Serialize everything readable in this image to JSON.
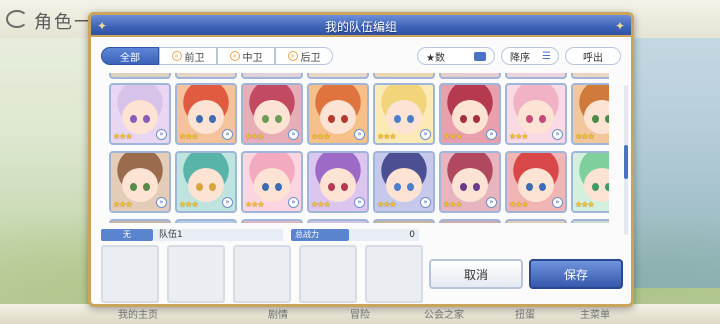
{
  "background": {
    "title": "角色一览",
    "nav": [
      "我的主页",
      "剧情",
      "冒险",
      "公会之家",
      "扭蛋",
      "主菜单"
    ]
  },
  "dialog": {
    "title": "我的队伍编组"
  },
  "filters": {
    "tabs": [
      {
        "label": "全部",
        "active": true
      },
      {
        "label": "前卫",
        "active": false
      },
      {
        "label": "中卫",
        "active": false
      },
      {
        "label": "后卫",
        "active": false
      }
    ],
    "star_sort": "★数",
    "order": "降序",
    "call": "呼出"
  },
  "grid": {
    "rows": [
      [
        {
          "hair": "#d7c2ea",
          "eye": "#8b5bb7",
          "bg": "#e8d6f2",
          "stars": "★★★"
        },
        {
          "hair": "#e05b3f",
          "eye": "#3f6db5",
          "bg": "#f4c29b",
          "stars": "★★★"
        },
        {
          "hair": "#c24a63",
          "eye": "#6a9b57",
          "bg": "#e8aeb8",
          "stars": "★★★"
        },
        {
          "hair": "#e0743f",
          "eye": "#b33a2e",
          "bg": "#f6c08a",
          "stars": "★★★"
        },
        {
          "hair": "#f2d57a",
          "eye": "#4d7ecb",
          "bg": "#fbeab6",
          "stars": "★★★"
        },
        {
          "hair": "#b5394f",
          "eye": "#a22f3a",
          "bg": "#e8a0ad",
          "stars": "★★★"
        },
        {
          "hair": "#f2b2c6",
          "eye": "#c74a7c",
          "bg": "#f9d9e3",
          "stars": "★★★"
        },
        {
          "hair": "#cf7a3b",
          "eye": "#4a8a4a",
          "bg": "#f1c79b",
          "stars": "★★★"
        }
      ],
      [
        {
          "hair": "#9a6b4c",
          "eye": "#5a8a4a",
          "bg": "#e4cdb8",
          "stars": "★★★"
        },
        {
          "hair": "#58b3a8",
          "eye": "#d9a43a",
          "bg": "#bfe3de",
          "stars": "★★★"
        },
        {
          "hair": "#f3a9be",
          "eye": "#3f6db5",
          "bg": "#fbd6e0",
          "stars": "★★★"
        },
        {
          "hair": "#9d6bc6",
          "eye": "#b33a52",
          "bg": "#dcc5ef",
          "stars": "★★★"
        },
        {
          "hair": "#4d4f93",
          "eye": "#4d7ecb",
          "bg": "#c7c9ec",
          "stars": "★★★"
        },
        {
          "hair": "#b04860",
          "eye": "#6b3a8a",
          "bg": "#e7b5c0",
          "stars": "★★★"
        },
        {
          "hair": "#d84848",
          "eye": "#3f6db5",
          "bg": "#f2b5b5",
          "stars": "★★★"
        },
        {
          "hair": "#7fcf9c",
          "eye": "#3f9a63",
          "bg": "#d2f0dd",
          "stars": "★★★"
        }
      ]
    ]
  },
  "team": {
    "label": "无",
    "name": "队伍1",
    "power_label": "总战力",
    "power_value": "0"
  },
  "buttons": {
    "cancel": "取消",
    "save": "保存"
  },
  "colors": {
    "accent": "#3d63b8",
    "gold_border": "#c9a45a",
    "star": "#f3c22b"
  }
}
